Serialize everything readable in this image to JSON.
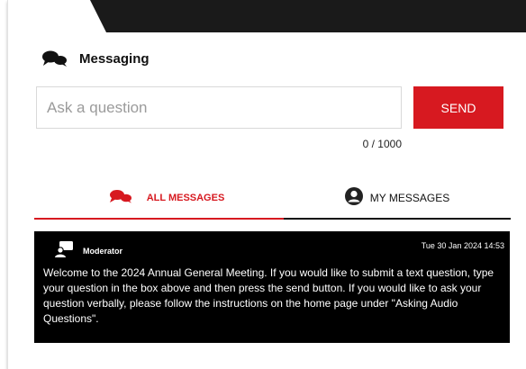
{
  "header": {
    "title": "Messaging",
    "icon": "chat-bubbles-icon"
  },
  "composer": {
    "placeholder": "Ask a question",
    "value": "",
    "send_label": "SEND",
    "counter": "0 / 1000"
  },
  "tabs": [
    {
      "label": "ALL MESSAGES",
      "icon": "chat-bubbles-icon",
      "active": true
    },
    {
      "label": "MY MESSAGES",
      "icon": "user-avatar-icon",
      "active": false
    }
  ],
  "messages": [
    {
      "author": "Moderator",
      "icon": "moderator-icon",
      "timestamp": "Tue 30 Jan 2024 14:53",
      "body": "Welcome to the 2024 Annual General Meeting. If you would like to submit a text question, type your question in the box above and then press the send button. If you would like to ask your question verbally, please follow the instructions on the home page under \"Asking Audio Questions\"."
    }
  ],
  "colors": {
    "accent": "#d71920",
    "card_bg": "#000000",
    "banner": "#1a1a1a"
  }
}
